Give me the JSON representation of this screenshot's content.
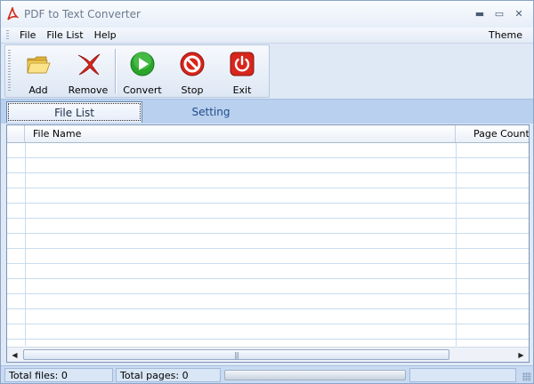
{
  "window": {
    "title": "PDF to Text Converter",
    "minimize_glyph": "▬",
    "maximize_glyph": "▭",
    "close_glyph": "✕"
  },
  "menu": {
    "file": "File",
    "file_list": "File List",
    "help": "Help",
    "theme": "Theme"
  },
  "toolbar": {
    "add": {
      "label": "Add",
      "icon": "folder-open-icon"
    },
    "remove": {
      "label": "Remove",
      "icon": "red-x-icon"
    },
    "convert": {
      "label": "Convert",
      "icon": "play-icon"
    },
    "stop": {
      "label": "Stop",
      "icon": "stop-icon"
    },
    "exit": {
      "label": "Exit",
      "icon": "power-icon"
    }
  },
  "tabs": {
    "file_list": "File List",
    "setting": "Setting"
  },
  "grid": {
    "columns": {
      "file_name": "File Name",
      "page_count": "Page Count"
    },
    "rows": [],
    "scroll_thumb_glyph": "|||"
  },
  "status": {
    "total_files": "Total files: 0",
    "total_pages": "Total pages: 0",
    "progress": 0
  },
  "colors": {
    "accent": "#b9d1ee",
    "pdf_red": "#d32a1c",
    "convert_green": "#2aa52a",
    "stop_red": "#d8251b"
  }
}
